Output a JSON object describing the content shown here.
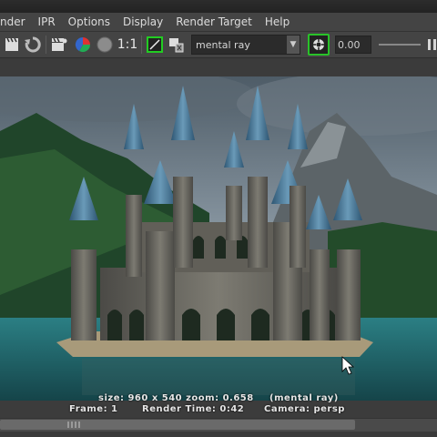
{
  "menu": {
    "items": [
      "nder",
      "IPR",
      "Options",
      "Display",
      "Render Target",
      "Help"
    ]
  },
  "toolbar": {
    "ratio_label": "1:1",
    "renderer": "mental ray",
    "exposure": "0.00",
    "icons": [
      "clapper-icon",
      "refresh-icon",
      "clapper-settings-icon",
      "color-channels-icon",
      "alpha-circle-icon",
      "region-icon",
      "snapshot-remove-icon",
      "keep-image-icon",
      "pause-icon"
    ]
  },
  "status": {
    "line1_size": "size: 960 x 540 zoom: 0.658",
    "line1_renderer": "(mental ray)",
    "frame": "Frame: 1",
    "render_time": "Render Time: 0:42",
    "camera": "Camera: persp"
  },
  "colors": {
    "accent_green": "#29c229",
    "panel_bg": "#444444",
    "water": "#1f5e63"
  }
}
